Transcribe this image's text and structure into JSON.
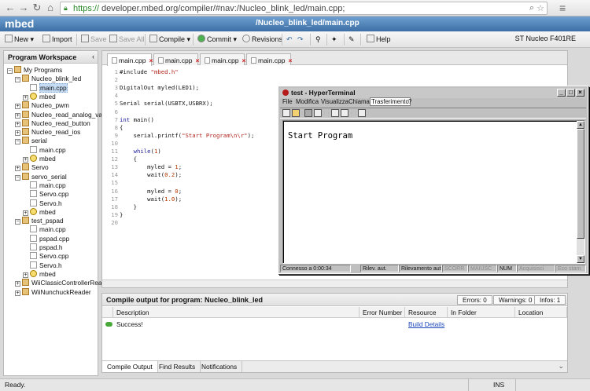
{
  "browser": {
    "url_scheme": "https://",
    "url_rest": "developer.mbed.org/compiler/#nav:/Nucleo_blink_led/main.cpp;",
    "back_icon": "arrow-left-icon",
    "forward_icon": "arrow-right-icon",
    "reload_icon": "reload-icon",
    "home_icon": "home-icon"
  },
  "header": {
    "logo": "mbed",
    "file_path": "/Nucleo_blink_led/main.cpp"
  },
  "toolbar": {
    "new": "New",
    "import": "Import",
    "save": "Save",
    "save_all": "Save All",
    "compile": "Compile",
    "commit": "Commit",
    "revisions": "Revisions",
    "help": "Help",
    "platform": "ST Nucleo F401RE"
  },
  "workspace": {
    "title": "Program Workspace",
    "tree": [
      {
        "label": "My Programs",
        "icon": "prog",
        "exp": "−"
      },
      {
        "label": "Nucleo_blink_led",
        "icon": "prog",
        "exp": "−"
      },
      {
        "label": "main.cpp",
        "icon": "cpp",
        "exp": "",
        "selected": true
      },
      {
        "label": "mbed",
        "icon": "lib",
        "exp": "+"
      },
      {
        "label": "Nucleo_pwm",
        "icon": "prog",
        "exp": "+"
      },
      {
        "label": "Nucleo_read_analog_va",
        "icon": "prog",
        "exp": "+"
      },
      {
        "label": "Nucleo_read_button",
        "icon": "prog",
        "exp": "+"
      },
      {
        "label": "Nucleo_read_ios",
        "icon": "prog",
        "exp": "+"
      },
      {
        "label": "serial",
        "icon": "prog",
        "exp": "−"
      },
      {
        "label": "main.cpp",
        "icon": "cpp",
        "exp": ""
      },
      {
        "label": "mbed",
        "icon": "lib",
        "exp": "+"
      },
      {
        "label": "Servo",
        "icon": "prog",
        "exp": "+"
      },
      {
        "label": "servo_serial",
        "icon": "prog",
        "exp": "−"
      },
      {
        "label": "main.cpp",
        "icon": "cpp",
        "exp": ""
      },
      {
        "label": "Servo.cpp",
        "icon": "cpp",
        "exp": ""
      },
      {
        "label": "Servo.h",
        "icon": "cpp",
        "exp": ""
      },
      {
        "label": "mbed",
        "icon": "lib",
        "exp": "+"
      },
      {
        "label": "test_pspad",
        "icon": "prog",
        "exp": "−"
      },
      {
        "label": "main.cpp",
        "icon": "cpp",
        "exp": ""
      },
      {
        "label": "pspad.cpp",
        "icon": "cpp",
        "exp": ""
      },
      {
        "label": "pspad.h",
        "icon": "cpp",
        "exp": ""
      },
      {
        "label": "Servo.cpp",
        "icon": "cpp",
        "exp": ""
      },
      {
        "label": "Servo.h",
        "icon": "cpp",
        "exp": ""
      },
      {
        "label": "mbed",
        "icon": "lib",
        "exp": "+"
      },
      {
        "label": "WiiClassicControllerRead",
        "icon": "prog",
        "exp": "+"
      },
      {
        "label": "WiiNunchuckReader",
        "icon": "prog",
        "exp": "+"
      }
    ]
  },
  "editor": {
    "tabs": [
      "main.cpp",
      "main.cpp",
      "main.cpp",
      "main.cpp"
    ],
    "lines": [
      "#include \"mbed.h\"",
      "",
      "DigitalOut myled(LED1);",
      "",
      "Serial serial(USBTX,USBRX);",
      "",
      "int main()",
      "{",
      "    serial.printf(\"Start Program\\n\\r\");",
      "",
      "    while(1)",
      "    {",
      "        myled = 1;",
      "        wait(0.2);",
      "",
      "        myled = 0;",
      "        wait(1.0);",
      "    }",
      "}",
      ""
    ]
  },
  "compile": {
    "title": "Compile output for program: Nucleo_blink_led",
    "errors": "Errors: 0",
    "warnings": "Warnings: 0",
    "infos": "Infos: 1",
    "columns": [
      "Description",
      "Error Number",
      "Resource",
      "In Folder",
      "Location"
    ],
    "row": {
      "description": "Success!",
      "error_number": "",
      "resource": "Build Details",
      "in_folder": "",
      "location": ""
    },
    "tabs": [
      "Compile Output",
      "Find Results",
      "Notifications"
    ]
  },
  "hyperterminal": {
    "title": "test - HyperTerminal",
    "menu": [
      "File",
      "Modifica",
      "Visualizza",
      "Chiama",
      "Trasferimento",
      "?"
    ],
    "output": "Start Program",
    "status": [
      "Connesso a 0:00:34",
      "Rilev. aut.",
      "Rilevamento auto",
      "SCORR",
      "MAIUSC",
      "NUM",
      "Acquisisci",
      "Eco stam"
    ]
  },
  "statusbar": {
    "left": "Ready.",
    "mode": "INS"
  },
  "colors": {
    "header_blue": "#4a7fb5",
    "hyperterm_title": "#c8c8c8"
  }
}
